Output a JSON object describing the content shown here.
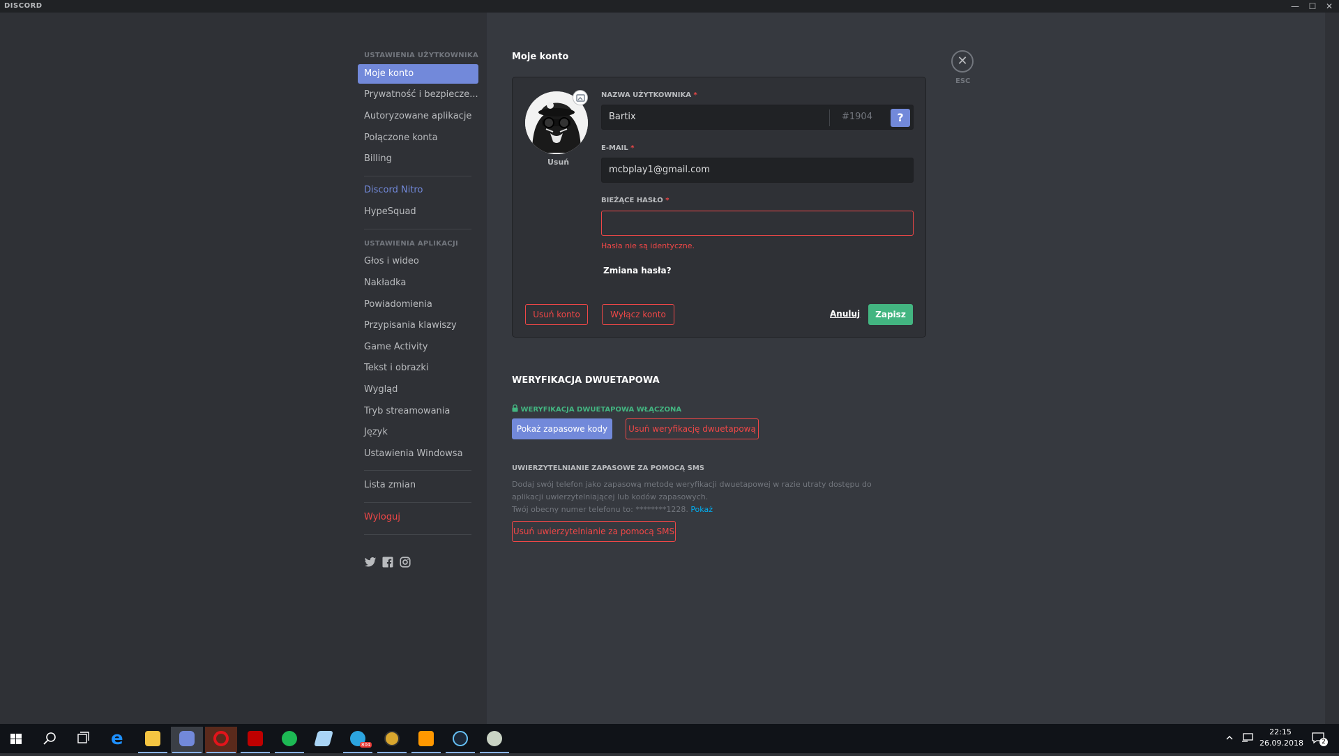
{
  "window": {
    "title": "DISCORD",
    "controls": [
      "—",
      "☐",
      "✕"
    ]
  },
  "sidebar": {
    "user_settings_header": "Ustawienia użytkownika",
    "user_items": [
      "Moje konto",
      "Prywatność i bezpiecze...",
      "Autoryzowane aplikacje",
      "Połączone konta",
      "Billing"
    ],
    "nitro": "Discord Nitro",
    "hypesquad": "HypeSquad",
    "app_settings_header": "Ustawienia aplikacji",
    "app_items": [
      "Głos i wideo",
      "Nakładka",
      "Powiadomienia",
      "Przypisania klawiszy",
      "Game Activity",
      "Tekst i obrazki",
      "Wygląd",
      "Tryb streamowania",
      "Język",
      "Ustawienia Windowsa"
    ],
    "changelog": "Lista zmian",
    "logout": "Wyloguj",
    "social_icons": [
      "twitter-icon",
      "facebook-icon",
      "instagram-icon"
    ]
  },
  "account": {
    "title": "Moje konto",
    "avatar_remove": "Usuń",
    "username_label": "Nazwa użytkownika",
    "username": "Bartix",
    "discriminator": "#1904",
    "help": "?",
    "email_label": "E-mail",
    "email": "mcbplay1@gmail.com",
    "password_label": "Bieżące hasło",
    "password_value": "",
    "password_error": "Hasła nie są identyczne.",
    "change_password": "Zmiana hasła?",
    "delete_account": "Usuń konto",
    "disable_account": "Wyłącz konto",
    "cancel": "Anuluj",
    "save": "Zapisz",
    "required_mark": "*"
  },
  "close": {
    "symbol": "✕",
    "label": "ESC"
  },
  "twofa": {
    "title": "Weryfikacja dwuetapowa",
    "enabled_label": "Weryfikacja dwuetapowa włączona",
    "show_codes": "Pokaż zapasowe kody",
    "remove_2fa": "Usuń weryfikację dwuetapową",
    "sms_title": "Uwierzytelnianie zapasowe za pomocą SMS",
    "sms_desc_1": "Dodaj swój telefon jako zapasową metodę weryfikacji dwuetapowej w razie utraty dostępu do aplikacji uwierzytelniającej lub kodów zapasowych.",
    "sms_desc_2": "Twój obecny numer telefonu to: ********1228.",
    "sms_show": "Pokaż",
    "remove_sms": "Usuń uwierzytelnianie za pomocą SMS"
  },
  "colors": {
    "accent": "#7289da",
    "danger": "#f04747",
    "success": "#43b581",
    "bg_dark": "#2f3136",
    "bg_content": "#36393f"
  },
  "taskbar": {
    "apps": [
      "windows-start-icon",
      "search-icon",
      "task-view-icon",
      "edge-icon",
      "file-explorer-icon",
      "discord-icon",
      "opera-icon",
      "filezilla-icon",
      "spotify-icon",
      "notepad-icon",
      "telegram-icon",
      "hearthstone-icon",
      "sublime-icon",
      "steam-icon",
      "game-icon"
    ],
    "telegram_badge": "804",
    "time": "22:15",
    "date": "26.09.2018",
    "notifications": "2"
  }
}
